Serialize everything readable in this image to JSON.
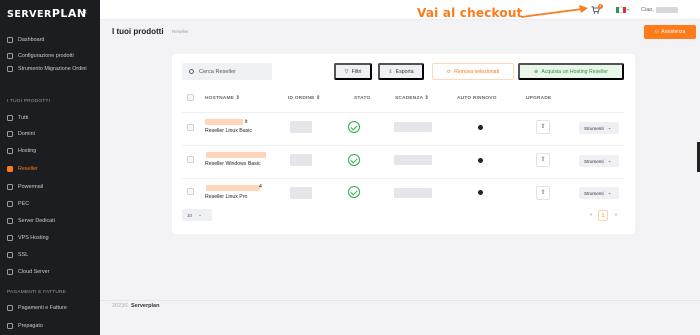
{
  "brand": {
    "logo_a": "SERVER",
    "logo_b": "PLAN",
    "collapse": "«"
  },
  "annotation": {
    "label": "Vai al checkout"
  },
  "topbar": {
    "cart_badge": "1",
    "greeting": "Ciao,"
  },
  "sidebar": {
    "top_items": [
      {
        "label": "Dashboard"
      },
      {
        "label": "Configurazione prodotti"
      },
      {
        "label": "Strumento Migrazione Ordini"
      }
    ],
    "section1": "I TUOI PRODOTTI",
    "products": [
      {
        "label": "Tutti"
      },
      {
        "label": "Domini"
      },
      {
        "label": "Hosting"
      },
      {
        "label": "Reseller"
      },
      {
        "label": "Powermail"
      },
      {
        "label": "PEC"
      },
      {
        "label": "Server Dedicati"
      },
      {
        "label": "VPS Hosting"
      },
      {
        "label": "SSL"
      },
      {
        "label": "Cloud Server"
      }
    ],
    "section2": "PAGAMENTI E FATTURE",
    "billing": [
      {
        "label": "Pagamenti e Fatture"
      },
      {
        "label": "Prepagato"
      }
    ]
  },
  "page": {
    "title": "I tuoi prodotti",
    "breadcrumb": "Reseller",
    "assist_button": "Assistenza"
  },
  "toolbar": {
    "search_placeholder": "Cerca Reseller",
    "filters": "Filtri",
    "export": "Esporta",
    "renew_selected": "Rinnova selezionati",
    "buy": "Acquista un Hosting Reseller"
  },
  "table": {
    "headers": [
      "HOSTNAME",
      "ID ORDINE",
      "STATO",
      "SCADENZA",
      "AUTO RINNOVO",
      "UPGRADE"
    ],
    "rows": [
      {
        "hostname_suffix": "it",
        "product": "Reseller Linux Basic",
        "tools": "Strumenti"
      },
      {
        "hostname_suffix": "",
        "product": "Reseller Windows Basic",
        "tools": "Strumenti"
      },
      {
        "hostname_suffix": "4",
        "product": "Reseller Linux Pro",
        "tools": "Strumenti"
      }
    ],
    "page_size": "10",
    "pages": [
      "«",
      "1",
      "»"
    ]
  },
  "footer": {
    "year": "2023©",
    "brand": "Serverplan"
  },
  "colors": {
    "accent": "#ff7a1a",
    "sidebar": "#1b1d21",
    "ok": "#2faf45"
  }
}
